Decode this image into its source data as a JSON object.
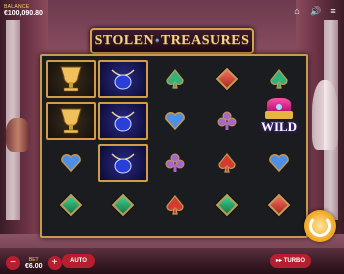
{
  "header": {
    "balance_label": "BALANCE",
    "balance_value": "€100,090.80"
  },
  "top_icons": [
    "home-icon",
    "volume-icon",
    "menu-icon"
  ],
  "title": {
    "part1": "STOLEN",
    "separator": "•",
    "part2": "TREASURES"
  },
  "reels": {
    "symbols": [
      [
        "gold-chalice",
        "gold-chalice",
        "blue-heart",
        "green-diamond"
      ],
      [
        "sapphire-necklace",
        "sapphire-necklace",
        "sapphire-necklace",
        "green-diamond"
      ],
      [
        "green-spade",
        "blue-heart",
        "purple-club",
        "red-spade"
      ],
      [
        "red-diamond-suit",
        "purple-club",
        "red-spade",
        "green-diamond"
      ],
      [
        "green-spade",
        "wild",
        "blue-heart",
        "red-diamond-suit"
      ]
    ],
    "wild_label": "WILD"
  },
  "bottom": {
    "bet_label": "BET",
    "bet_value": "€6.00",
    "minus": "−",
    "plus": "+",
    "auto_label": "AUTO",
    "turbo_label": "TURBO"
  },
  "colors": {
    "accent": "#b61f2f",
    "gold": "#d39b45",
    "spin": "#f0a51f"
  }
}
